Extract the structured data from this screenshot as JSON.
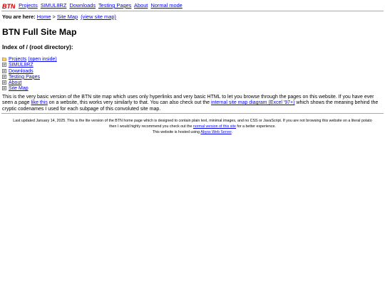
{
  "nav": {
    "logo": "BTN",
    "links": [
      "Projects",
      "SIMUL8RZ",
      "Downloads",
      "Testing Pages",
      "About",
      "Normal mode"
    ]
  },
  "breadcrumb": {
    "prefix": "You are here:",
    "home": "Home",
    "sep": ">",
    "current": "Site Map",
    "view_link": "(view site map)"
  },
  "page": {
    "title": "BTN Full Site Map",
    "index_heading": "Index of / (root directory):"
  },
  "files": [
    {
      "name": "Projects",
      "extra": "(open inside)",
      "icon": "folder-icon"
    },
    {
      "name": "SIMUL8RZ",
      "icon": "file-icon"
    },
    {
      "name": "Downloads",
      "icon": "file-icon"
    },
    {
      "name": "Testing Pages",
      "icon": "file-icon"
    },
    {
      "name": "About",
      "icon": "file-icon"
    },
    {
      "name": "Site Map",
      "icon": "file-icon"
    }
  ],
  "description": {
    "part1": "This is the very basic version of the BTN site map which uses only hyperlinks and very basic HTML to let you browse through the pages on this website. If you have ever seen a page ",
    "link1": "like this",
    "part2": " on a website, this works very similarly to that. You can also check out the ",
    "link2": "internal site map diagram (Excel '97+)",
    "part3": " which shows the meaning behind the cryptic codenames I used for each subpage of this convoluted site map."
  },
  "footer": {
    "line1": "Last updated January 14, 2025. This is the lite version of the BTN home page which is designed to contain plain text, minimal images, and no CSS or JavaScript. If you are not browsing this website on a literal potato",
    "line2_a": "then I would highly recommend you check out the ",
    "line2_link": "normal version of this site",
    "line2_b": " for a better experience.",
    "line3_a": "This website is hosted using ",
    "line3_link": "Abyss Web Server",
    "line3_b": "."
  },
  "colors": {
    "link": "#0000ee",
    "logo_red": "#cc0000",
    "rule": "#a9a9a9"
  }
}
